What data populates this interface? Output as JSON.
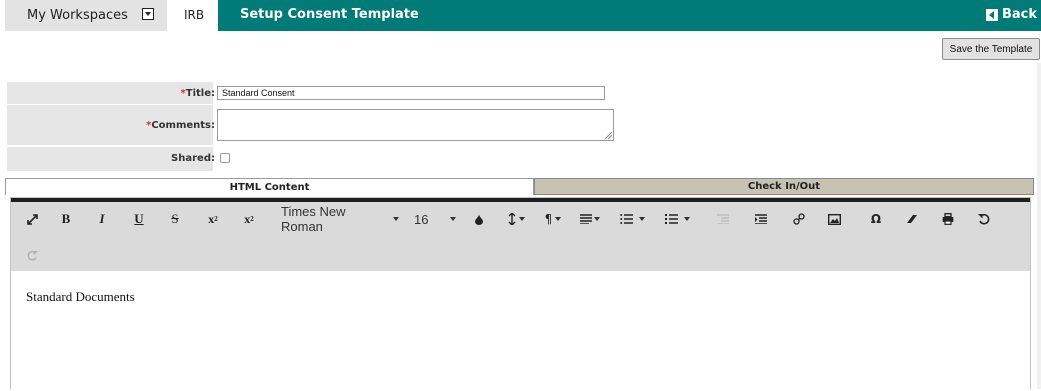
{
  "topbar": {
    "workspaces_label": "My Workspaces",
    "section_label": "IRB",
    "page_title": "Setup Consent Template",
    "back_label": "Back"
  },
  "actions": {
    "save_label": "Save the Template"
  },
  "form": {
    "title_label": "Title:",
    "title_value": "Standard Consent",
    "comments_label": "Comments:",
    "comments_value": "",
    "shared_label": "Shared:",
    "shared_checked": false,
    "required_mark": "*"
  },
  "tabs": [
    {
      "label": "HTML Content",
      "active": true
    },
    {
      "label": "Check In/Out",
      "active": false
    }
  ],
  "editor": {
    "font_family": "Times New Roman",
    "font_size": "16",
    "content": "Standard Documents",
    "toolbar_icons": [
      "fullscreen-icon",
      "bold-icon",
      "italic-icon",
      "underline-icon",
      "strikethrough-icon",
      "subscript-icon",
      "superscript-icon",
      "font-family-select",
      "font-size-select",
      "color-icon",
      "line-height-icon",
      "paragraph-icon",
      "align-icon",
      "ordered-list-icon",
      "unordered-list-icon",
      "outdent-icon",
      "indent-icon",
      "link-icon",
      "image-icon",
      "special-char-icon",
      "eraser-icon",
      "print-icon",
      "undo-icon",
      "redo-icon"
    ]
  },
  "colors": {
    "header_teal": "#007b78",
    "label_bg": "#e6e6e6",
    "toolbar_bg": "#dadada",
    "inactive_tab_bg": "#c8c2b5",
    "required": "#d2302c"
  }
}
